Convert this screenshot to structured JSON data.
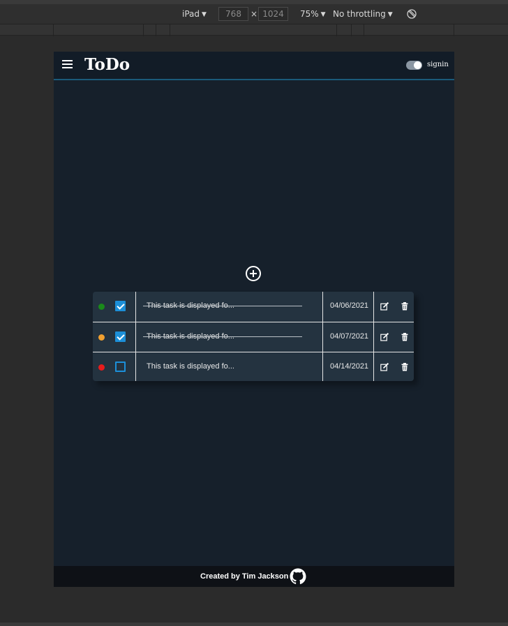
{
  "devtools": {
    "device": "iPad",
    "width_value": "768",
    "times": "×",
    "height_value": "1024",
    "zoom": "75%",
    "throttling": "No throttling",
    "rotate_icon": "rotate-icon"
  },
  "app": {
    "title": "ToDo",
    "menu_icon": "hamburger-icon",
    "signin_label": "signin",
    "toggle_on": true,
    "add_icon": "plus-circle-icon",
    "tasks": [
      {
        "priority_color": "#1a8a1a",
        "completed": true,
        "text": "This task is displayed fo...",
        "date": "04/06/2021"
      },
      {
        "priority_color": "#f0a030",
        "completed": true,
        "text": "This task is displayed fo...",
        "date": "04/07/2021"
      },
      {
        "priority_color": "#e81c1c",
        "completed": false,
        "text": "This task is displayed fo...",
        "date": "04/14/2021"
      }
    ],
    "footer": {
      "credit": "Created by Tim Jackson",
      "github_icon": "github-icon"
    }
  },
  "colors": {
    "accent": "#1c8fd8",
    "background": "#16202b",
    "table": "#243340"
  }
}
